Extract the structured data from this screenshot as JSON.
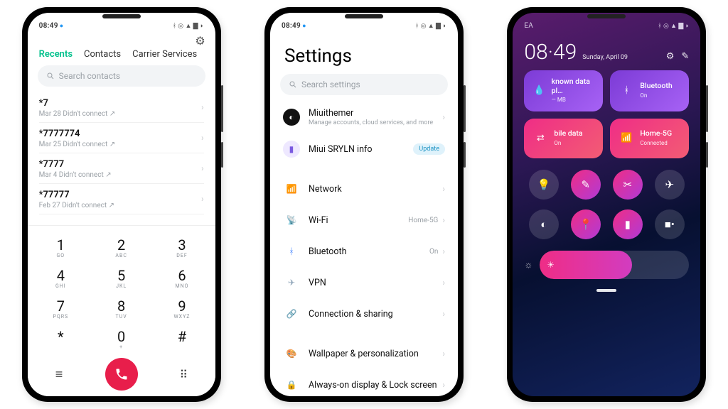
{
  "status": {
    "time": "08:49",
    "carrier": "EA"
  },
  "dialer": {
    "tabs": [
      "Recents",
      "Contacts",
      "Carrier Services"
    ],
    "search_placeholder": "Search contacts",
    "calls": [
      {
        "number": "*7",
        "meta": "Mar 28 Didn't connect"
      },
      {
        "number": "*7777774",
        "meta": "Mar 25 Didn't connect"
      },
      {
        "number": "*7777",
        "meta": "Mar 4 Didn't connect"
      },
      {
        "number": "*77777",
        "meta": "Feb 27 Didn't connect"
      }
    ],
    "keys": [
      [
        "1",
        "GO"
      ],
      [
        "2",
        "ABC"
      ],
      [
        "3",
        "DEF"
      ],
      [
        "4",
        "GHI"
      ],
      [
        "5",
        "JKL"
      ],
      [
        "6",
        "MNO"
      ],
      [
        "7",
        "PQRS"
      ],
      [
        "8",
        "TUV"
      ],
      [
        "9",
        "WXYZ"
      ],
      [
        "*",
        ""
      ],
      [
        "0",
        "+"
      ],
      [
        "#",
        ""
      ]
    ]
  },
  "settings": {
    "title": "Settings",
    "search_placeholder": "Search settings",
    "account": {
      "name": "Miuithemer",
      "sub": "Manage accounts, cloud services, and more"
    },
    "info": {
      "label": "Miui SRYLN info",
      "badge": "Update"
    },
    "items": [
      {
        "icon": "📶",
        "color": "#f9c22b",
        "label": "Network",
        "trail": ""
      },
      {
        "icon": "📡",
        "color": "#39b8ff",
        "label": "Wi-Fi",
        "trail": "Home-5G"
      },
      {
        "icon": "ᚼ",
        "color": "#3a7dff",
        "label": "Bluetooth",
        "trail": "On"
      },
      {
        "icon": "✈",
        "color": "#8ea4b8",
        "label": "VPN",
        "trail": ""
      },
      {
        "icon": "🔗",
        "color": "#ff7a59",
        "label": "Connection & sharing",
        "trail": ""
      }
    ],
    "items2": [
      {
        "icon": "🎨",
        "color": "#ff7e5f",
        "label": "Wallpaper & personalization"
      },
      {
        "icon": "🔒",
        "color": "#ff8a65",
        "label": "Always-on display & Lock screen"
      }
    ]
  },
  "cc": {
    "time": "08·49",
    "date": "Sunday, April 09",
    "tiles": [
      {
        "style": "t-purple",
        "icon": "💧",
        "title": "known data pl…",
        "sub": "— MB"
      },
      {
        "style": "t-purple",
        "icon": "ᚼ",
        "title": "Bluetooth",
        "sub": "On"
      },
      {
        "style": "t-pink",
        "icon": "⇄",
        "title": "bile data",
        "sub": "On"
      },
      {
        "style": "t-pink",
        "icon": "📶",
        "title": "Home-5G",
        "sub": "Connected"
      }
    ],
    "quick": [
      {
        "icon": "💡",
        "on": false
      },
      {
        "icon": "✎",
        "on": true
      },
      {
        "icon": "✂",
        "on": true
      },
      {
        "icon": "✈",
        "on": false
      },
      {
        "icon": "◐",
        "on": false
      },
      {
        "icon": "📍",
        "on": true
      },
      {
        "icon": "▮",
        "on": true
      },
      {
        "icon": "■•",
        "on": false
      }
    ]
  }
}
